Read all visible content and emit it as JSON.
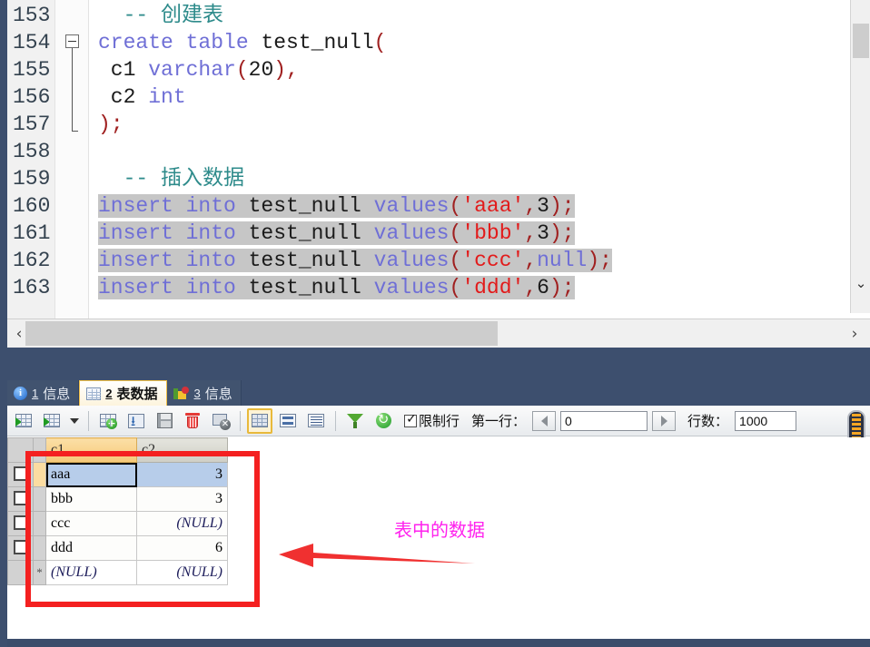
{
  "editor": {
    "lines": [
      {
        "num": "153",
        "tokens": [
          {
            "t": "  ",
            "c": "plain"
          },
          {
            "t": "-- 创建表",
            "c": "cmt"
          }
        ]
      },
      {
        "num": "154",
        "tokens": [
          {
            "t": "create table",
            "c": "kw"
          },
          {
            "t": " test_null",
            "c": "plain"
          },
          {
            "t": "(",
            "c": "punc"
          }
        ]
      },
      {
        "num": "155",
        "tokens": [
          {
            "t": " c1 ",
            "c": "plain"
          },
          {
            "t": "varchar",
            "c": "kw"
          },
          {
            "t": "(",
            "c": "punc"
          },
          {
            "t": "20",
            "c": "num"
          },
          {
            "t": ")",
            "c": "punc"
          },
          {
            "t": ",",
            "c": "punc"
          }
        ]
      },
      {
        "num": "156",
        "tokens": [
          {
            "t": " c2 ",
            "c": "plain"
          },
          {
            "t": "int",
            "c": "kw"
          }
        ]
      },
      {
        "num": "157",
        "tokens": [
          {
            "t": ")",
            "c": "punc"
          },
          {
            "t": ";",
            "c": "punc"
          }
        ]
      },
      {
        "num": "158",
        "tokens": []
      },
      {
        "num": "159",
        "tokens": [
          {
            "t": "  ",
            "c": "plain"
          },
          {
            "t": "-- 插入数据",
            "c": "cmt"
          }
        ]
      },
      {
        "num": "160",
        "sel": true,
        "tokens": [
          {
            "t": "insert into",
            "c": "kw"
          },
          {
            "t": " test_null ",
            "c": "plain"
          },
          {
            "t": "values",
            "c": "kw"
          },
          {
            "t": "(",
            "c": "punc"
          },
          {
            "t": "'aaa'",
            "c": "str"
          },
          {
            "t": ",",
            "c": "punc"
          },
          {
            "t": "3",
            "c": "num"
          },
          {
            "t": ")",
            "c": "punc"
          },
          {
            "t": ";",
            "c": "punc"
          }
        ]
      },
      {
        "num": "161",
        "sel": true,
        "tokens": [
          {
            "t": "insert into",
            "c": "kw"
          },
          {
            "t": " test_null ",
            "c": "plain"
          },
          {
            "t": "values",
            "c": "kw"
          },
          {
            "t": "(",
            "c": "punc"
          },
          {
            "t": "'bbb'",
            "c": "str"
          },
          {
            "t": ",",
            "c": "punc"
          },
          {
            "t": "3",
            "c": "num"
          },
          {
            "t": ")",
            "c": "punc"
          },
          {
            "t": ";",
            "c": "punc"
          }
        ]
      },
      {
        "num": "162",
        "sel": true,
        "tokens": [
          {
            "t": "insert into",
            "c": "kw"
          },
          {
            "t": " test_null ",
            "c": "plain"
          },
          {
            "t": "values",
            "c": "kw"
          },
          {
            "t": "(",
            "c": "punc"
          },
          {
            "t": "'ccc'",
            "c": "str"
          },
          {
            "t": ",",
            "c": "punc"
          },
          {
            "t": "null",
            "c": "kw"
          },
          {
            "t": ")",
            "c": "punc"
          },
          {
            "t": ";",
            "c": "punc"
          }
        ]
      },
      {
        "num": "163",
        "sel": true,
        "tokens": [
          {
            "t": "insert into",
            "c": "kw"
          },
          {
            "t": " test_null ",
            "c": "plain"
          },
          {
            "t": "values",
            "c": "kw"
          },
          {
            "t": "(",
            "c": "punc"
          },
          {
            "t": "'ddd'",
            "c": "str"
          },
          {
            "t": ",",
            "c": "punc"
          },
          {
            "t": "6",
            "c": "num"
          },
          {
            "t": ")",
            "c": "punc"
          },
          {
            "t": ";",
            "c": "punc"
          }
        ]
      }
    ],
    "hscroll_left_icon": "‹",
    "hscroll_right_icon": "›",
    "vscroll_down_icon": "⌄"
  },
  "tabs": [
    {
      "num": "1",
      "label": "信息",
      "icon": "info-icon",
      "active": false
    },
    {
      "num": "2",
      "label": "表数据",
      "icon": "table-grid-icon",
      "active": true
    },
    {
      "num": "3",
      "label": "信息",
      "icon": "chart-icon",
      "active": false
    }
  ],
  "toolbar": {
    "buttons": [
      {
        "name": "export-grid-button",
        "icon": "grid-export-icon"
      },
      {
        "name": "import-grid-button",
        "icon": "grid-import-icon"
      },
      {
        "name": "import-dropdown-button",
        "icon": "chevron-down-icon"
      },
      {
        "name": "add-record-button",
        "icon": "grid-add-icon"
      },
      {
        "name": "apply-changes-button",
        "icon": "apply-blue-icon"
      },
      {
        "name": "save-button",
        "icon": "floppy-save-icon"
      },
      {
        "name": "delete-record-button",
        "icon": "trash-icon"
      },
      {
        "name": "discard-changes-button",
        "icon": "grid-cancel-icon"
      },
      {
        "name": "view-grid-button",
        "icon": "grid-view-icon",
        "selected": true
      },
      {
        "name": "view-split-button",
        "icon": "split-view-icon"
      },
      {
        "name": "view-form-button",
        "icon": "form-view-icon"
      },
      {
        "name": "filter-button",
        "icon": "funnel-icon"
      },
      {
        "name": "refresh-button",
        "icon": "refresh-green-icon"
      }
    ],
    "limit_rows_label": "限制行",
    "limit_rows_checked": true,
    "first_row_label": "第一行：",
    "first_row_value": "0",
    "row_count_label": "行数：",
    "row_count_value": "1000",
    "prev_icon": "triangle-left-icon",
    "next_icon": "triangle-right-icon"
  },
  "grid": {
    "columns": [
      "c1",
      "c2"
    ],
    "active_column": "c1",
    "rows": [
      {
        "c1": "aaa",
        "c2": "3",
        "selected": true,
        "current": true
      },
      {
        "c1": "bbb",
        "c2": "3"
      },
      {
        "c1": "ccc",
        "c2": "(NULL)",
        "c2_null": true
      },
      {
        "c1": "ddd",
        "c2": "6"
      }
    ],
    "new_row": {
      "c1": "(NULL)",
      "c2": "(NULL)",
      "marker": "*"
    }
  },
  "annotation": {
    "text": "表中的数据",
    "text_color": "#ff22ee",
    "box_color": "#f42020",
    "arrow_color": "#f03030"
  }
}
